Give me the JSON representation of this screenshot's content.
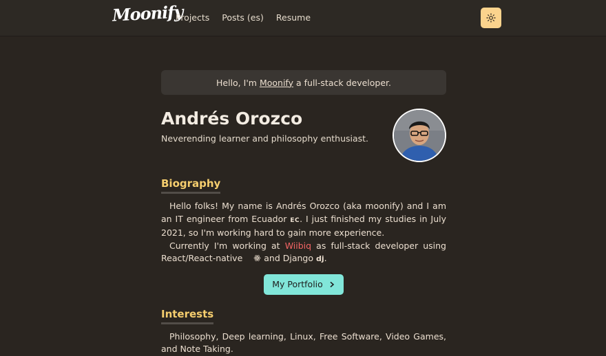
{
  "nav": {
    "logo_text": "Moonify",
    "links": [
      "Projects",
      "Posts (es)",
      "Resume"
    ],
    "theme_toggle_icon": "sun-icon"
  },
  "intro": {
    "before": "Hello, I'm",
    "link": "Moonify",
    "after": "a full-stack developer."
  },
  "profile": {
    "name": "Andrés Orozco",
    "tagline": "Neverending learner and philosophy enthusiast."
  },
  "biography": {
    "title": "Biography",
    "p1": "Hello folks! My name is Andrés Orozco (aka moonify) and I am an IT engineer from Ecuador",
    "flag_code": "EC",
    "p1_end": ". I just finished my studies in July 2021, so I'm working hard to gain more experience.",
    "p2_a": "Currently I'm working at",
    "company": "Wiibiq",
    "p2_b": "as full-stack developer using React/React-native",
    "p2_c": "and Django",
    "django_icon_text": "dj",
    "p2_end": "."
  },
  "portfolio_button": {
    "label": "My Portfolio",
    "icon": "chevron-right-icon"
  },
  "interests": {
    "title": "Interests",
    "text": "Philosophy, Deep learning, Linux, Free Software, Video Games, and Note Taking."
  },
  "colors": {
    "background": "#2a2520",
    "accent_yellow": "#f6ce6e",
    "button_teal": "#81e6d9",
    "link_red": "#f56565",
    "toggle_bg": "#fbd38d"
  }
}
